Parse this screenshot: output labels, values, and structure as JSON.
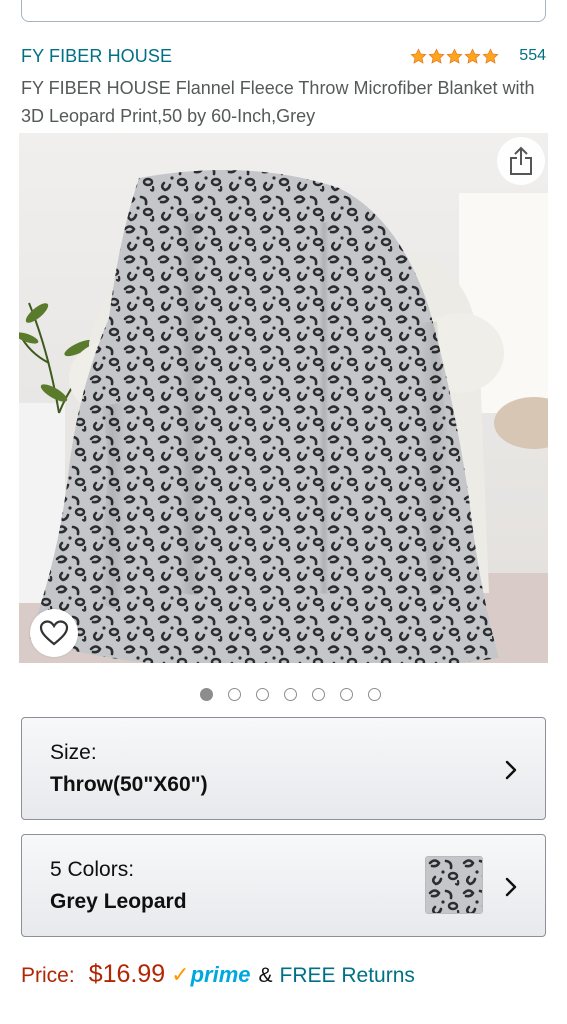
{
  "product": {
    "brand": "FY FIBER HOUSE",
    "rating_stars": 5,
    "review_count": "554",
    "title": "FY FIBER HOUSE Flannel Fleece Throw Microfiber Blanket with 3D Leopard Print,50 by 60-Inch,Grey",
    "image_subject": "grey leopard print fleece blanket draped over a white armchair",
    "image_count": 7,
    "active_image_index": 0
  },
  "size": {
    "label": "Size:",
    "value": "Throw(50\"X60\")"
  },
  "colors": {
    "label": "5 Colors:",
    "value": "Grey Leopard"
  },
  "pricing": {
    "price_label": "Price:",
    "price": "$16.99",
    "prime_check": "✓",
    "prime_label": "prime",
    "separator": "&",
    "returns": "FREE Returns"
  },
  "icons": {
    "share": "share-icon",
    "wishlist": "heart-icon",
    "chevron": "chevron-right-icon",
    "star": "star-icon"
  },
  "colors_theme": {
    "link": "#007185",
    "price": "#b12704",
    "star": "#ffa41c",
    "prime": "#00a8e1",
    "prime_check": "#ff9900"
  }
}
